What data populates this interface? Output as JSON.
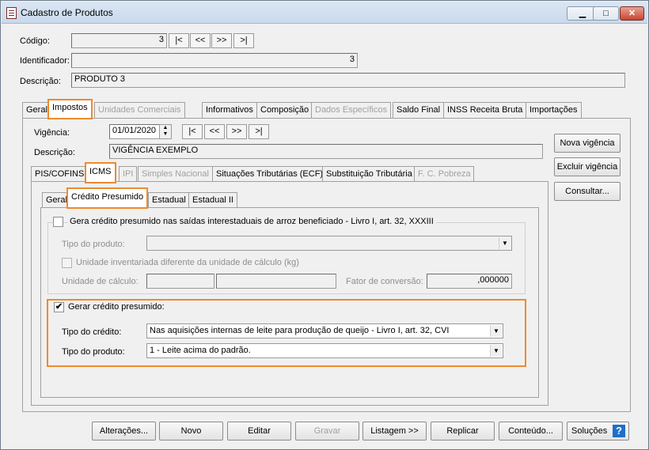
{
  "window": {
    "title": "Cadastro de Produtos",
    "min": "▁",
    "max": "□",
    "close": "✕"
  },
  "codigo": {
    "label": "Código:",
    "value": "3"
  },
  "nav": {
    "first": "|<",
    "prev": "<<",
    "next": ">>",
    "last": ">|"
  },
  "identificador": {
    "label": "Identificador:",
    "value": "3"
  },
  "descricao": {
    "label": "Descrição:",
    "value": "PRODUTO 3"
  },
  "main_tabs": [
    "Geral",
    "Impostos",
    "Unidades Comerciais",
    "Informativos",
    "Composição",
    "Dados Específicos",
    "Saldo Final",
    "INSS Receita Bruta",
    "Importações"
  ],
  "vigencia": {
    "label": "Vigência:",
    "value": "01/01/2020",
    "desc_label": "Descrição:",
    "desc_value": "VIGÊNCIA EXEMPLO"
  },
  "side_buttons": {
    "nova": "Nova vigência",
    "excluir": "Excluir vigência",
    "consultar": "Consultar..."
  },
  "tax_tabs": [
    "PIS/COFINS",
    "ICMS",
    "IPI",
    "Simples Nacional",
    "Situações Tributárias (ECF)",
    "Substituição Tributária",
    "F. C. Pobreza"
  ],
  "icms_tabs": [
    "Geral",
    "Crédito Presumido",
    "Estadual",
    "Estadual II"
  ],
  "arroz": {
    "check_label": "Gera crédito presumido nas saídas interestaduais de arroz beneficiado - Livro I, art. 32, XXXIII",
    "tipo_produto_label": "Tipo do produto:",
    "unidade_inv_label": "Unidade inventariada diferente da unidade de cálculo (kg)",
    "unidade_calc_label": "Unidade de cálculo:",
    "fator_label": "Fator de conversão:",
    "fator_value": ",000000"
  },
  "credito": {
    "check_label": "Gerar crédito presumido:",
    "checked": "✔",
    "tipo_credito_label": "Tipo do crédito:",
    "tipo_credito_value": "Nas aquisições internas de leite para produção de queijo - Livro I, art. 32, CVI",
    "tipo_produto_label": "Tipo do produto:",
    "tipo_produto_value": "1 - Leite acima do padrão."
  },
  "bottom_buttons": {
    "alteracoes": "Alterações...",
    "novo": "Novo",
    "editar": "Editar",
    "gravar": "Gravar",
    "listagem": "Listagem >>",
    "replicar": "Replicar",
    "conteudo": "Conteúdo...",
    "solucoes": "Soluções",
    "help": "?"
  }
}
